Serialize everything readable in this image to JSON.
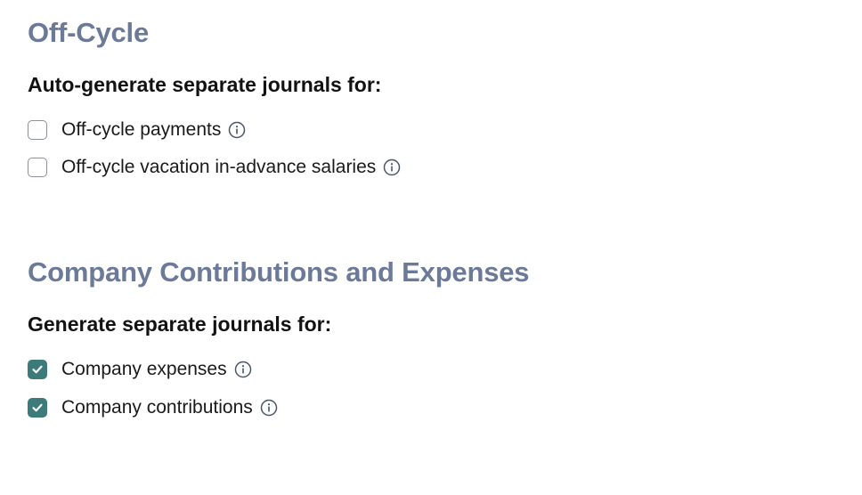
{
  "offcycle": {
    "title": "Off-Cycle",
    "subheading": "Auto-generate separate journals for:",
    "options": [
      {
        "label": "Off-cycle payments",
        "checked": false,
        "icon": "info-icon"
      },
      {
        "label": "Off-cycle vacation in-advance salaries",
        "checked": false,
        "icon": "info-icon"
      }
    ]
  },
  "contributions": {
    "title": "Company Contributions and Expenses",
    "subheading": "Generate separate journals for:",
    "options": [
      {
        "label": "Company expenses",
        "checked": true,
        "icon": "info-icon"
      },
      {
        "label": "Company contributions",
        "checked": true,
        "icon": "info-icon"
      }
    ]
  },
  "colors": {
    "section_title": "#6b7a99",
    "checkbox_checked": "#3d7a7a",
    "checkbox_border": "#8a8f99"
  }
}
